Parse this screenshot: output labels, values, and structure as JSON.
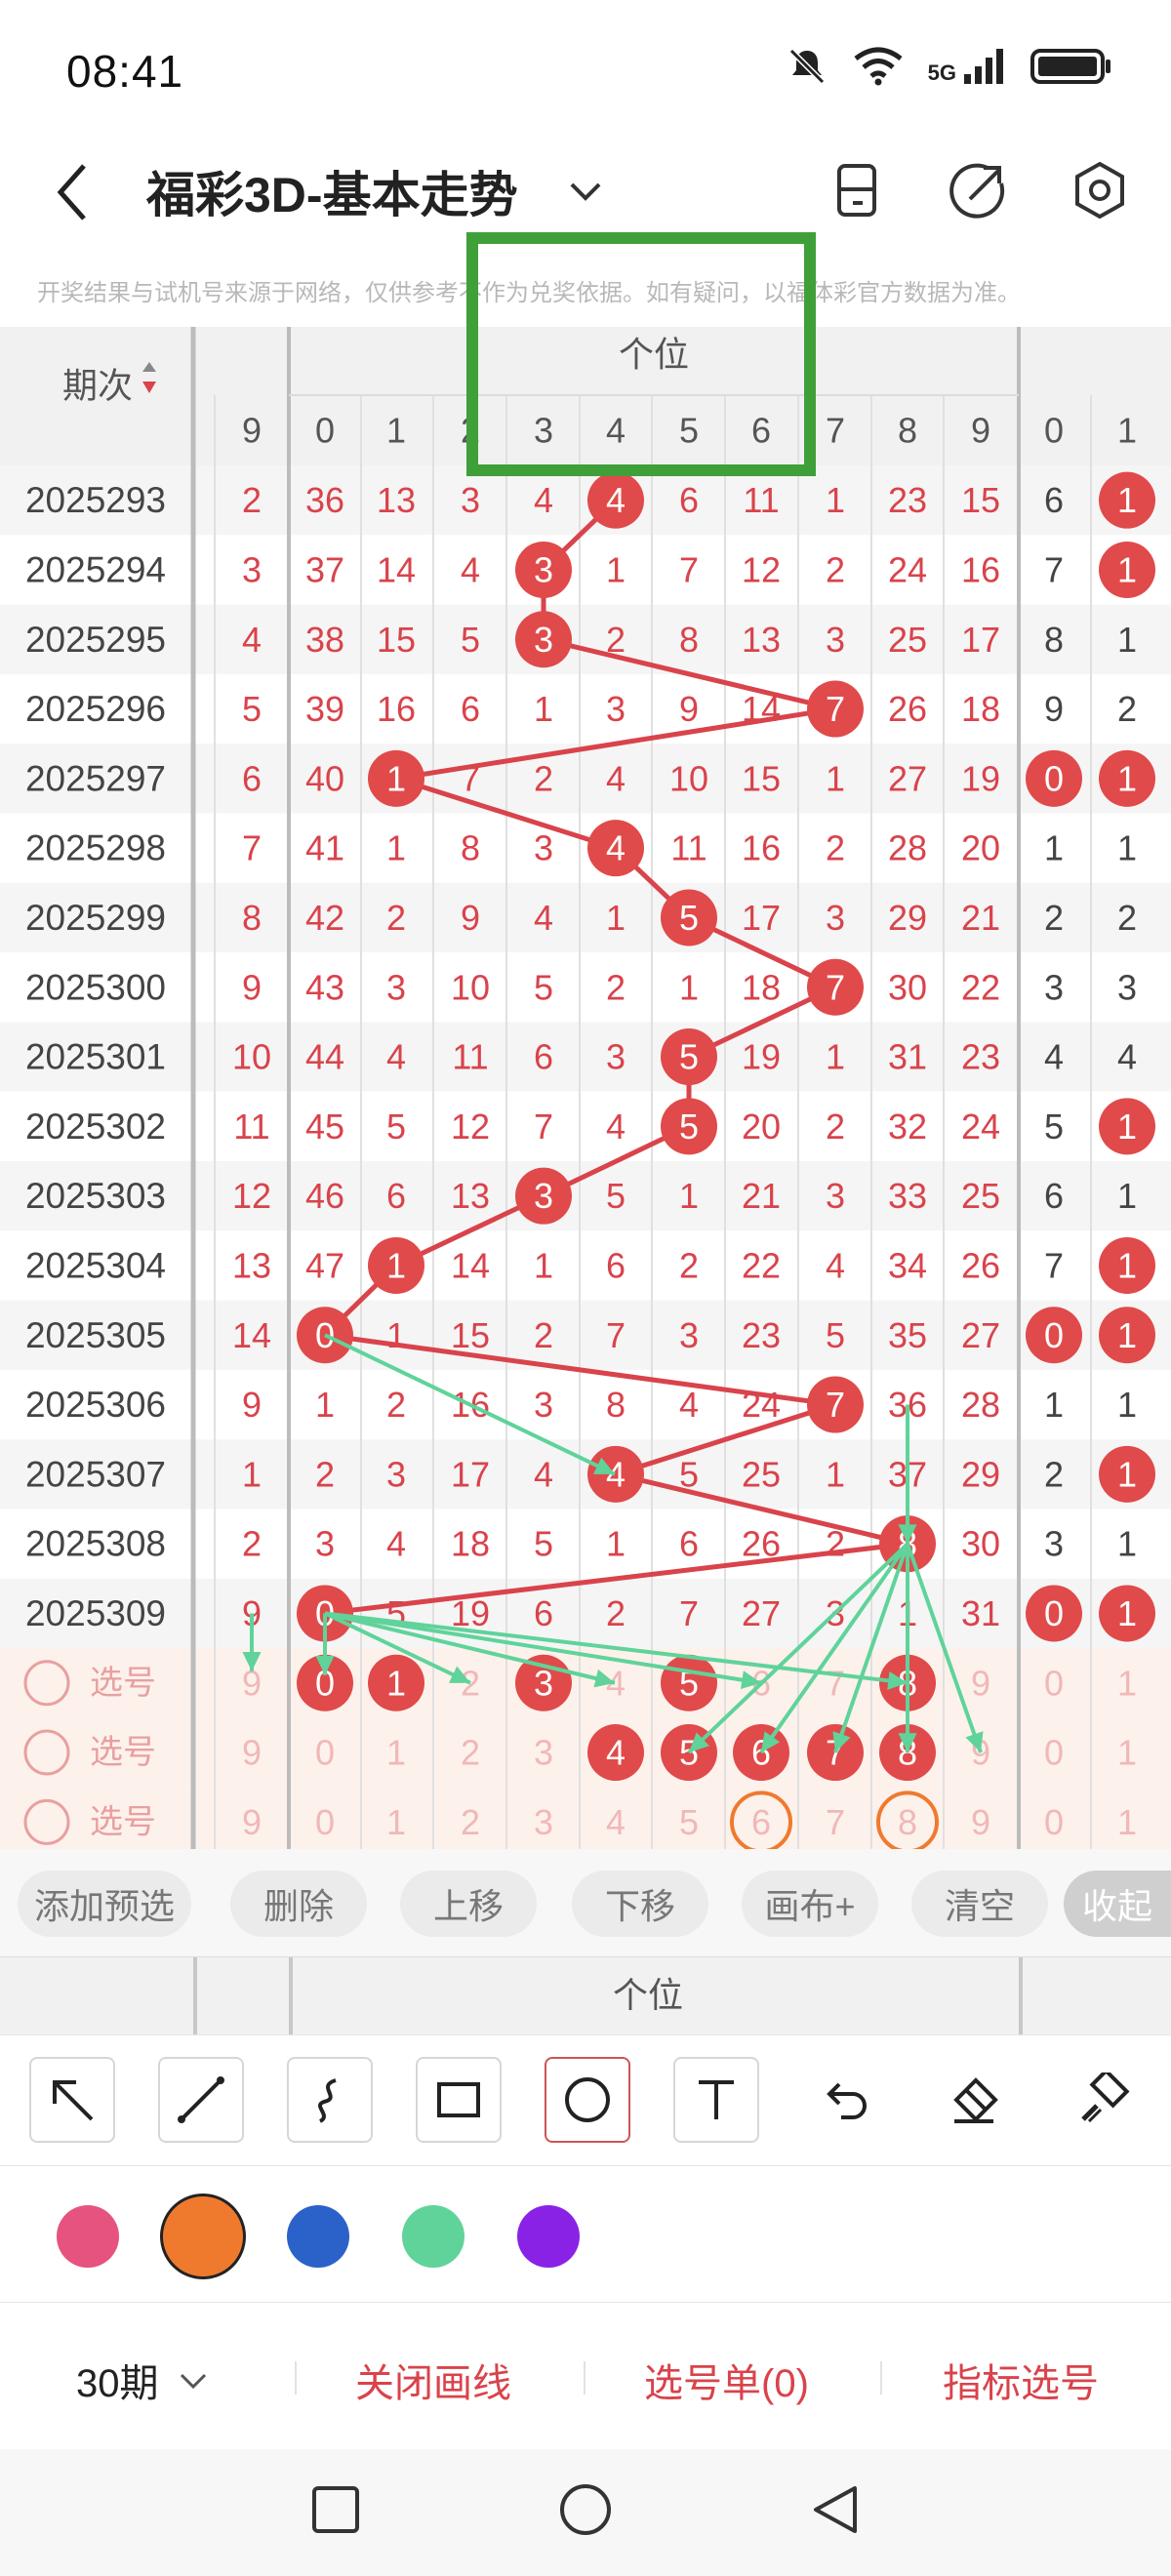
{
  "status_bar": {
    "time": "08:41",
    "network": "5G"
  },
  "header": {
    "title": "福彩3D-基本走势"
  },
  "disclaimer": "开奖结果与试机号来源于网络，仅供参考不作为兑奖依据。如有疑问，以福体彩官方数据为准。",
  "table": {
    "period_header": "期次",
    "group_header": "个位",
    "column_headers": [
      "9",
      "0",
      "1",
      "2",
      "3",
      "4",
      "5",
      "6",
      "7",
      "8",
      "9",
      "0",
      "1"
    ],
    "rows": [
      {
        "period": "2025293",
        "left": "2",
        "cells": [
          "36",
          "13",
          "3",
          "4",
          "4",
          "6",
          "11",
          "1",
          "23",
          "15"
        ],
        "tail": [
          "6",
          "1"
        ],
        "hit": 4,
        "tail_hit": [
          1
        ]
      },
      {
        "period": "2025294",
        "left": "3",
        "cells": [
          "37",
          "14",
          "4",
          "3",
          "1",
          "7",
          "12",
          "2",
          "24",
          "16"
        ],
        "tail": [
          "7",
          "1"
        ],
        "hit": 3,
        "tail_hit": [
          1
        ]
      },
      {
        "period": "2025295",
        "left": "4",
        "cells": [
          "38",
          "15",
          "5",
          "3",
          "2",
          "8",
          "13",
          "3",
          "25",
          "17"
        ],
        "tail": [
          "8",
          "1"
        ],
        "hit": 3,
        "tail_hit": []
      },
      {
        "period": "2025296",
        "left": "5",
        "cells": [
          "39",
          "16",
          "6",
          "1",
          "3",
          "9",
          "14",
          "7",
          "26",
          "18"
        ],
        "tail": [
          "9",
          "2"
        ],
        "hit": 7,
        "tail_hit": []
      },
      {
        "period": "2025297",
        "left": "6",
        "cells": [
          "40",
          "1",
          "7",
          "2",
          "4",
          "10",
          "15",
          "1",
          "27",
          "19"
        ],
        "tail": [
          "0",
          "1"
        ],
        "hit": 1,
        "tail_hit": [
          0,
          1
        ]
      },
      {
        "period": "2025298",
        "left": "7",
        "cells": [
          "41",
          "1",
          "8",
          "3",
          "4",
          "11",
          "16",
          "2",
          "28",
          "20"
        ],
        "tail": [
          "1",
          "1"
        ],
        "hit": 4,
        "tail_hit": []
      },
      {
        "period": "2025299",
        "left": "8",
        "cells": [
          "42",
          "2",
          "9",
          "4",
          "1",
          "5",
          "17",
          "3",
          "29",
          "21"
        ],
        "tail": [
          "2",
          "2"
        ],
        "hit": 5,
        "tail_hit": []
      },
      {
        "period": "2025300",
        "left": "9",
        "cells": [
          "43",
          "3",
          "10",
          "5",
          "2",
          "1",
          "18",
          "7",
          "30",
          "22"
        ],
        "tail": [
          "3",
          "3"
        ],
        "hit": 7,
        "tail_hit": []
      },
      {
        "period": "2025301",
        "left": "10",
        "cells": [
          "44",
          "4",
          "11",
          "6",
          "3",
          "5",
          "19",
          "1",
          "31",
          "23"
        ],
        "tail": [
          "4",
          "4"
        ],
        "hit": 5,
        "tail_hit": []
      },
      {
        "period": "2025302",
        "left": "11",
        "cells": [
          "45",
          "5",
          "12",
          "7",
          "4",
          "5",
          "20",
          "2",
          "32",
          "24"
        ],
        "tail": [
          "5",
          "1"
        ],
        "hit": 5,
        "tail_hit": [
          1
        ]
      },
      {
        "period": "2025303",
        "left": "12",
        "cells": [
          "46",
          "6",
          "13",
          "3",
          "5",
          "1",
          "21",
          "3",
          "33",
          "25"
        ],
        "tail": [
          "6",
          "1"
        ],
        "hit": 3,
        "tail_hit": []
      },
      {
        "period": "2025304",
        "left": "13",
        "cells": [
          "47",
          "1",
          "14",
          "1",
          "6",
          "2",
          "22",
          "4",
          "34",
          "26"
        ],
        "tail": [
          "7",
          "1"
        ],
        "hit": 1,
        "tail_hit": [
          1
        ]
      },
      {
        "period": "2025305",
        "left": "14",
        "cells": [
          "0",
          "1",
          "15",
          "2",
          "7",
          "3",
          "23",
          "5",
          "35",
          "27"
        ],
        "tail": [
          "0",
          "1"
        ],
        "hit": 0,
        "tail_hit": [
          0,
          1
        ]
      },
      {
        "period": "2025306",
        "left": "9",
        "cells": [
          "1",
          "2",
          "16",
          "3",
          "8",
          "4",
          "24",
          "7",
          "36",
          "28"
        ],
        "tail": [
          "1",
          "1"
        ],
        "hit": 7,
        "tail_hit": []
      },
      {
        "period": "2025307",
        "left": "1",
        "cells": [
          "2",
          "3",
          "17",
          "4",
          "4",
          "5",
          "25",
          "1",
          "37",
          "29"
        ],
        "tail": [
          "2",
          "1"
        ],
        "hit": 4,
        "tail_hit": [
          1
        ]
      },
      {
        "period": "2025308",
        "left": "2",
        "cells": [
          "3",
          "4",
          "18",
          "5",
          "1",
          "6",
          "26",
          "2",
          "8",
          "30"
        ],
        "tail": [
          "3",
          "1"
        ],
        "hit": 8,
        "tail_hit": []
      },
      {
        "period": "2025309",
        "left": "9",
        "cells": [
          "0",
          "5",
          "19",
          "6",
          "2",
          "7",
          "27",
          "3",
          "1",
          "31"
        ],
        "tail": [
          "0",
          "1"
        ],
        "hit": 0,
        "tail_hit": [
          0,
          1
        ]
      }
    ],
    "pick_rows": [
      {
        "label": "选号",
        "left": "9",
        "cells": [
          "0",
          "1",
          "2",
          "3",
          "4",
          "5",
          "6",
          "7",
          "8",
          "9"
        ],
        "tail": [
          "0",
          "1"
        ]
      },
      {
        "label": "选号",
        "left": "9",
        "cells": [
          "0",
          "1",
          "2",
          "3",
          "4",
          "5",
          "6",
          "7",
          "8",
          "9"
        ],
        "tail": [
          "0",
          "1"
        ]
      },
      {
        "label": "选号",
        "left": "9",
        "cells": [
          "0",
          "1",
          "2",
          "3",
          "4",
          "5",
          "6",
          "7",
          "8",
          "9"
        ],
        "tail": [
          "0",
          "1"
        ]
      }
    ]
  },
  "actions": [
    "添加预选",
    "删除",
    "上移",
    "下移",
    "画布+",
    "清空",
    "收起"
  ],
  "draw_tools": [
    "arrow-tool",
    "line-tool",
    "curve-tool",
    "rectangle-tool",
    "circle-tool",
    "text-tool",
    "undo-tool",
    "eraser-tool",
    "brush-tool"
  ],
  "colors": [
    "#e6537e",
    "#ef7a2e",
    "#2a62c9",
    "#5fd39a",
    "#8a22e6"
  ],
  "bottom": {
    "periods": "30期",
    "close_draw": "关闭画线",
    "pick_list": "选号单(0)",
    "indicator": "指标选号"
  }
}
